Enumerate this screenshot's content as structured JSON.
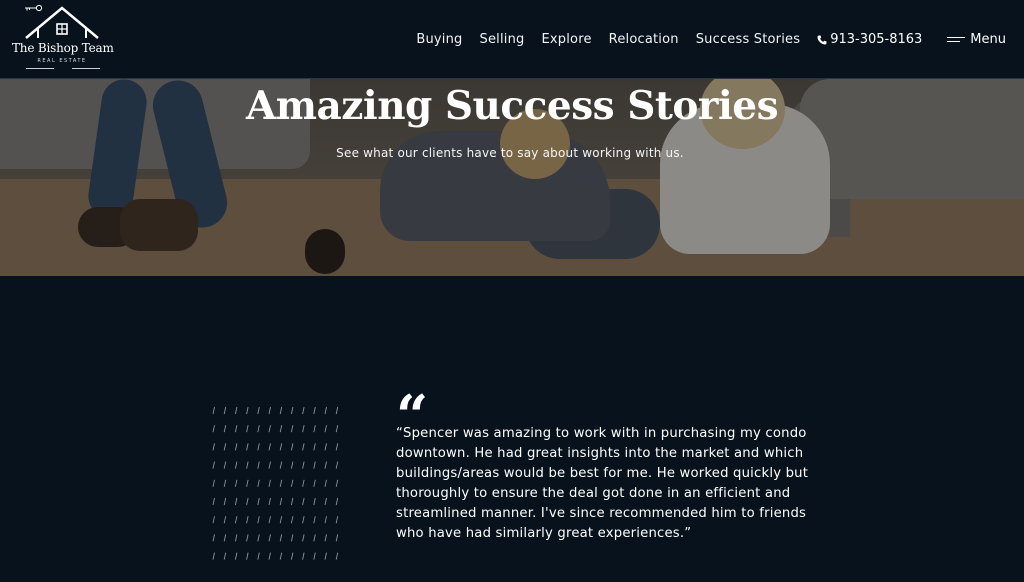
{
  "brand": {
    "name": "The Bishop Team",
    "tagline": "REAL ESTATE"
  },
  "nav": {
    "items": [
      "Buying",
      "Selling",
      "Explore",
      "Relocation",
      "Success Stories"
    ],
    "phone": "913-305-8163",
    "menu_label": "Menu"
  },
  "hero": {
    "title": "Amazing Success Stories",
    "subtitle": "See what our clients have to say about working with us."
  },
  "testimonial": {
    "quote_mark": "“",
    "text": "“Spencer was amazing to work with in purchasing my condo downtown. He had great insights into the market and which buildings/areas would be best for me. He worked quickly but thoroughly to ensure the deal got done in an efficient and streamlined manner. I've since recommended him to friends who have had similarly great experiences.”"
  },
  "colors": {
    "background": "#07121c",
    "text": "#ffffff"
  },
  "icons": {
    "logo": "house-icon",
    "phone": "phone-icon",
    "menu": "hamburger-icon"
  }
}
